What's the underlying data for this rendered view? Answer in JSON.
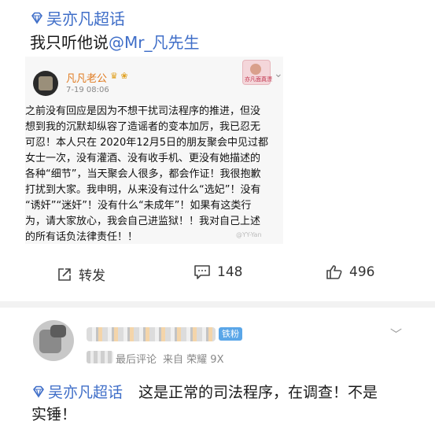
{
  "post": {
    "topic": "吴亦凡超话",
    "text_prefix": "我只听他说",
    "mention": "@Mr_凡先生"
  },
  "quoted_post": {
    "author": "凡凡老公",
    "badges": "♛ ❀",
    "time": "7-19 08:06",
    "sticker_caption": "亦凡面真漂",
    "body_lines": [
      "之前没有回应是因为不想干扰司法程序的推进，但没",
      "想到我的沉默却纵容了造谣者的变本加厉，我已忍无",
      "可忍！本人只在 2020年12月5日的朋友聚会中见过都",
      "女士一次，没有灌酒、没有收手机、更没有她描述的",
      "各种“细节”，当天聚会人很多，都会作证！我很抱歉",
      "打扰到大家。我申明，从来没有过什么“选妃”！没有",
      "“诱奸”“迷奸”！没有什么“未成年”！如果有这类行",
      "为，请大家放心，我会自己进监狱！！我对自己上述",
      "的所有话负法律责任！！"
    ],
    "watermark": "@YY-Yan"
  },
  "actions": {
    "repost_label": "转发",
    "comment_count": "148",
    "like_count": "496"
  },
  "comment": {
    "badge": "铁粉",
    "meta_suffix": "最后评论",
    "source_prefix": "来自",
    "device": "荣耀 9X",
    "topic": "吴亦凡超话",
    "text_line1": "这是正常的司法程序，在调查！不是",
    "text_line2": "实锤！"
  },
  "colors": {
    "topic_blue": "#3f6ec8",
    "author_orange": "#e07a1f",
    "badge_blue": "#5aa6e8"
  }
}
